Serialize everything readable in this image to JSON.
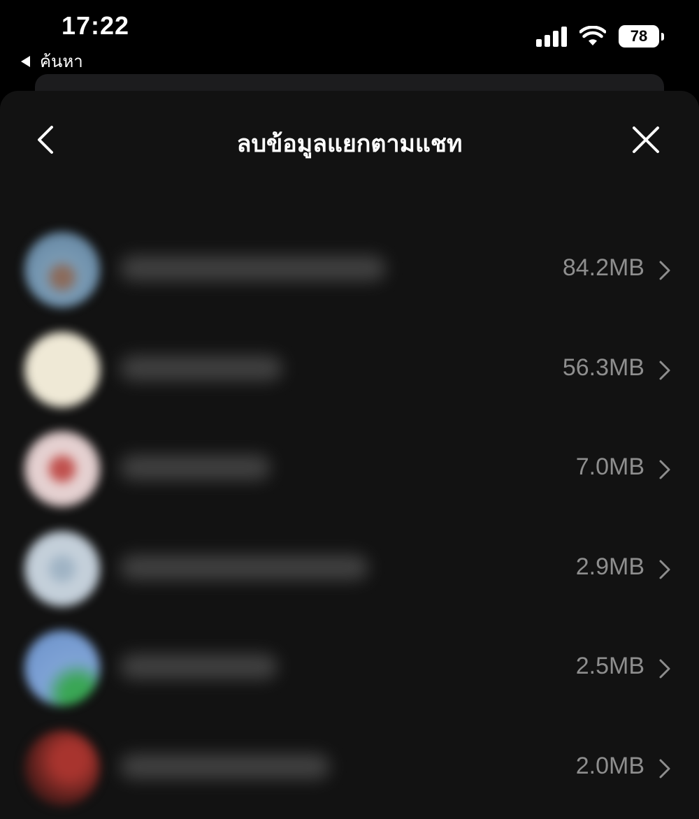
{
  "status_bar": {
    "time": "17:22",
    "back_app_label": "ค้นหา",
    "battery": "78",
    "signal_icon": "cellular-signal-icon",
    "wifi_icon": "wifi-icon"
  },
  "header": {
    "title": "ลบข้อมูลแยกตามแชท",
    "back_icon": "chevron-left-icon",
    "close_icon": "close-icon"
  },
  "chats": [
    {
      "size": "84.2MB",
      "avatar_color": "#7a9bb5"
    },
    {
      "size": "56.3MB",
      "avatar_color": "#efe9d6"
    },
    {
      "size": "7.0MB",
      "avatar_color": "#e8d4d4"
    },
    {
      "size": "2.9MB",
      "avatar_color": "#c7d2dc"
    },
    {
      "size": "2.5MB",
      "avatar_color": "#7fa3d6"
    },
    {
      "size": "2.0MB",
      "avatar_color": "#7a2a26"
    }
  ],
  "colors": {
    "background": "#000000",
    "sheet": "#121212",
    "size_text": "#8e8e8e",
    "chevron": "#8e8e8e"
  }
}
